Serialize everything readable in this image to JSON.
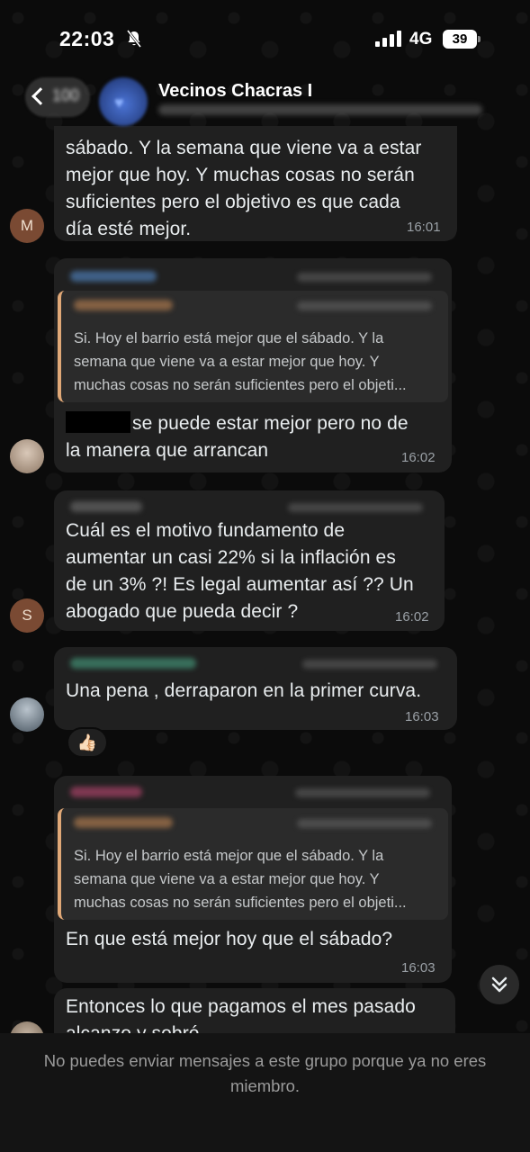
{
  "status_bar": {
    "time": "22:03",
    "network": "4G",
    "battery": "39"
  },
  "header": {
    "back_count": "100",
    "group_title": "Vecinos Chacras I"
  },
  "messages": [
    {
      "avatar_letter": "M",
      "lines": [
        "sábado. Y la semana que viene va a estar",
        "mejor que hoy. Y muchas cosas no serán",
        "suficientes pero el objetivo es que cada",
        "día esté mejor."
      ],
      "time": "16:01"
    },
    {
      "quote_lines": [
        "Si. Hoy el barrio está mejor que el sábado. Y la",
        "semana que viene va a estar mejor que hoy. Y",
        "muchas cosas no serán suficientes pero el objeti..."
      ],
      "line1_after_redaction": "se puede estar mejor pero no de",
      "line2": "la manera que arrancan",
      "time": "16:02"
    },
    {
      "avatar_letter": "S",
      "lines": [
        "Cuál es el motivo fundamento de",
        "aumentar un casi 22% si la inflación es",
        "de un 3% ?! Es legal aumentar así ?? Un",
        "abogado que pueda decir ?"
      ],
      "time": "16:02"
    },
    {
      "lines": [
        "Una pena , derraparon en la primer curva."
      ],
      "time": "16:03",
      "reaction": "👍🏻"
    },
    {
      "quote_lines": [
        "Si. Hoy el barrio está mejor que el sábado. Y la",
        "semana que viene va a estar mejor que hoy. Y",
        "muchas cosas no serán suficientes pero el objeti..."
      ],
      "lines": [
        "En que está mejor hoy que el sábado?"
      ],
      "time": "16:03"
    },
    {
      "lines": [
        "Entonces lo que pagamos el mes pasado",
        "alcanzo y sobró"
      ]
    }
  ],
  "footer": {
    "notice": "No puedes enviar mensajes a este grupo porque ya no eres miembro."
  }
}
